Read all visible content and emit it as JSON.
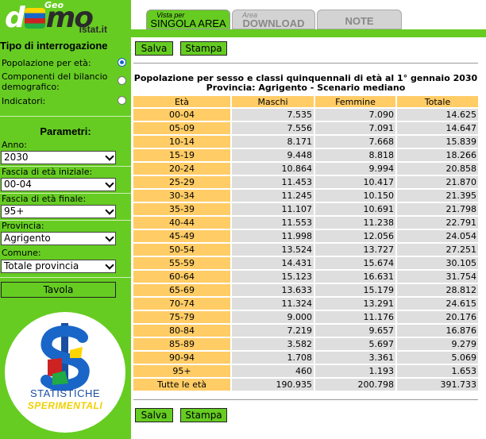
{
  "logo": {
    "geo": "Geo",
    "demo_d": "d",
    "demo_m": "mo",
    "istat": "istat.it"
  },
  "sidebar": {
    "query_title": "Tipo di interrogazione",
    "options": [
      {
        "label": "Popolazione per età:",
        "selected": true
      },
      {
        "label": "Componenti del bilancio demografico:",
        "selected": false
      },
      {
        "label": "Indicatori:",
        "selected": false
      }
    ],
    "params_title": "Parametri:",
    "anno": {
      "label": "Anno:",
      "value": "2030"
    },
    "eta_iniziale": {
      "label": "Fascia di età iniziale:",
      "value": "00-04"
    },
    "eta_finale": {
      "label": "Fascia di età finale:",
      "value": "95+"
    },
    "provincia": {
      "label": "Provincia:",
      "value": "Agrigento"
    },
    "comune": {
      "label": "Comune:",
      "value": "Totale provincia"
    },
    "tavola_label": "Tavola",
    "badge": {
      "line1": "STATISTICHE",
      "line2": "SPERIMENTALI"
    }
  },
  "tabs": [
    {
      "small": "Vista per",
      "label": "SINGOLA AREA",
      "active": true
    },
    {
      "small": "Area",
      "label": "DOWNLOAD",
      "active": false
    },
    {
      "small": "",
      "label": "NOTE",
      "active": false
    }
  ],
  "buttons": {
    "salva": "Salva",
    "stampa": "Stampa"
  },
  "table": {
    "title_line1": "Popolazione per sesso e classi quinquennali di età al 1° gennaio 2030",
    "title_line2": "Provincia: Agrigento - Scenario mediano",
    "headers": [
      "Età",
      "Maschi",
      "Femmine",
      "Totale"
    ],
    "rows": [
      [
        "00-04",
        "7.535",
        "7.090",
        "14.625"
      ],
      [
        "05-09",
        "7.556",
        "7.091",
        "14.647"
      ],
      [
        "10-14",
        "8.171",
        "7.668",
        "15.839"
      ],
      [
        "15-19",
        "9.448",
        "8.818",
        "18.266"
      ],
      [
        "20-24",
        "10.864",
        "9.994",
        "20.858"
      ],
      [
        "25-29",
        "11.453",
        "10.417",
        "21.870"
      ],
      [
        "30-34",
        "11.245",
        "10.150",
        "21.395"
      ],
      [
        "35-39",
        "11.107",
        "10.691",
        "21.798"
      ],
      [
        "40-44",
        "11.553",
        "11.238",
        "22.791"
      ],
      [
        "45-49",
        "11.998",
        "12.056",
        "24.054"
      ],
      [
        "50-54",
        "13.524",
        "13.727",
        "27.251"
      ],
      [
        "55-59",
        "14.431",
        "15.674",
        "30.105"
      ],
      [
        "60-64",
        "15.123",
        "16.631",
        "31.754"
      ],
      [
        "65-69",
        "13.633",
        "15.179",
        "28.812"
      ],
      [
        "70-74",
        "11.324",
        "13.291",
        "24.615"
      ],
      [
        "75-79",
        "9.000",
        "11.176",
        "20.176"
      ],
      [
        "80-84",
        "7.219",
        "9.657",
        "16.876"
      ],
      [
        "85-89",
        "3.582",
        "5.697",
        "9.279"
      ],
      [
        "90-94",
        "1.708",
        "3.361",
        "5.069"
      ],
      [
        "95+",
        "460",
        "1.193",
        "1.653"
      ],
      [
        "Tutte le età",
        "190.935",
        "200.798",
        "391.733"
      ]
    ]
  }
}
